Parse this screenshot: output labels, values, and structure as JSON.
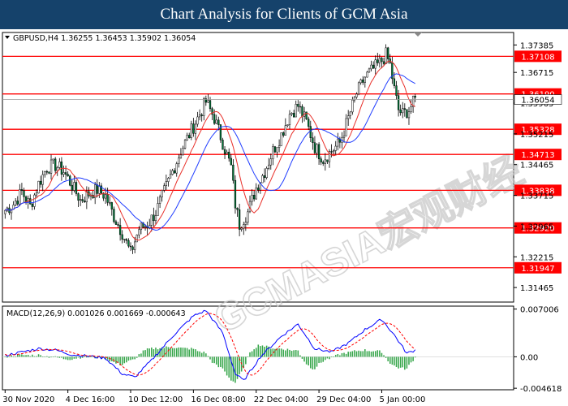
{
  "title": "Chart Analysis for Clients of GCM Asia",
  "watermark": "GCMASIA宏观财经",
  "colors": {
    "title_bg": "#15426b",
    "level_line": "#ff0000",
    "ma_red": "#e8302a",
    "ma_blue": "#1f3cff",
    "candle_bull": "#ffffff",
    "candle_bear": "#007a3a",
    "macd_hist": "#37a64b",
    "macd_line": "#0000ff",
    "signal_line": "#ff0000"
  },
  "chart_data": [
    {
      "type": "candlestick",
      "symbol_info": "GBPUSD,H4  1.36255 1.36453 1.35902 1.36054",
      "current_price_label": "1.36054",
      "y_ticks": [
        "1.37385",
        "1.36715",
        "1.35965",
        "1.35215",
        "1.34465",
        "1.33715",
        "1.32965",
        "1.32215",
        "1.31465"
      ],
      "ylim": [
        1.3115,
        1.3765
      ],
      "levels": [
        {
          "value": 1.37108,
          "label": "1.37108"
        },
        {
          "value": 1.3619,
          "label": "1.36190"
        },
        {
          "value": 1.35328,
          "label": "1.35328"
        },
        {
          "value": 1.34713,
          "label": "1.34713"
        },
        {
          "value": 1.33838,
          "label": "1.33838"
        },
        {
          "value": 1.3292,
          "label": "1.32920"
        },
        {
          "value": 1.31947,
          "label": "1.31947"
        }
      ],
      "anchors": [
        [
          0,
          1.3335
        ],
        [
          4,
          1.335
        ],
        [
          8,
          1.338
        ],
        [
          12,
          1.3345
        ],
        [
          16,
          1.34
        ],
        [
          20,
          1.344
        ],
        [
          24,
          1.3445
        ],
        [
          28,
          1.343
        ],
        [
          32,
          1.3395
        ],
        [
          36,
          1.336
        ],
        [
          40,
          1.3375
        ],
        [
          44,
          1.3385
        ],
        [
          48,
          1.337
        ],
        [
          52,
          1.332
        ],
        [
          56,
          1.328
        ],
        [
          60,
          1.323
        ],
        [
          64,
          1.329
        ],
        [
          68,
          1.33
        ],
        [
          72,
          1.333
        ],
        [
          76,
          1.338
        ],
        [
          80,
          1.343
        ],
        [
          84,
          1.348
        ],
        [
          88,
          1.352
        ],
        [
          92,
          1.356
        ],
        [
          96,
          1.36
        ],
        [
          100,
          1.356
        ],
        [
          104,
          1.35
        ],
        [
          108,
          1.344
        ],
        [
          110,
          1.335
        ],
        [
          112,
          1.33
        ],
        [
          116,
          1.333
        ],
        [
          120,
          1.339
        ],
        [
          124,
          1.343
        ],
        [
          128,
          1.348
        ],
        [
          132,
          1.352
        ],
        [
          136,
          1.357
        ],
        [
          140,
          1.359
        ],
        [
          144,
          1.355
        ],
        [
          148,
          1.349
        ],
        [
          152,
          1.346
        ],
        [
          156,
          1.348
        ],
        [
          160,
          1.35
        ],
        [
          164,
          1.356
        ],
        [
          168,
          1.362
        ],
        [
          172,
          1.366
        ],
        [
          176,
          1.368
        ],
        [
          180,
          1.37
        ],
        [
          182,
          1.3715
        ],
        [
          184,
          1.369
        ],
        [
          186,
          1.363
        ],
        [
          188,
          1.358
        ],
        [
          190,
          1.357
        ],
        [
          193,
          1.358
        ],
        [
          196,
          1.3605
        ]
      ]
    },
    {
      "type": "macd",
      "label": "MACD(12,26,9) 0.001026 0.001669 -0.000643",
      "y_ticks": [
        "0.007006",
        "0.00",
        "-0.004618"
      ],
      "ylim": [
        -0.0046,
        0.0072
      ],
      "anchors": [
        [
          0,
          0.0002
        ],
        [
          8,
          0.0007
        ],
        [
          16,
          0.0012
        ],
        [
          24,
          0.001
        ],
        [
          32,
          0.0003
        ],
        [
          40,
          0.0001
        ],
        [
          48,
          -0.0002
        ],
        [
          56,
          -0.0025
        ],
        [
          62,
          -0.003
        ],
        [
          70,
          -0.0005
        ],
        [
          80,
          0.003
        ],
        [
          90,
          0.006
        ],
        [
          96,
          0.0068
        ],
        [
          104,
          0.0035
        ],
        [
          110,
          -0.0025
        ],
        [
          114,
          -0.0035
        ],
        [
          122,
          0.0
        ],
        [
          132,
          0.003
        ],
        [
          140,
          0.0048
        ],
        [
          148,
          0.0012
        ],
        [
          156,
          0.0007
        ],
        [
          164,
          0.002
        ],
        [
          172,
          0.004
        ],
        [
          180,
          0.0055
        ],
        [
          186,
          0.0032
        ],
        [
          192,
          0.0005
        ],
        [
          196,
          0.001
        ]
      ]
    }
  ],
  "x_ticks": [
    {
      "bar": 0,
      "label": "30 Nov 2020"
    },
    {
      "bar": 30,
      "label": "4 Dec 16:00"
    },
    {
      "bar": 60,
      "label": "10 Dec 12:00"
    },
    {
      "bar": 90,
      "label": "16 Dec 08:00"
    },
    {
      "bar": 120,
      "label": "22 Dec 04:00"
    },
    {
      "bar": 150,
      "label": "29 Dec 04:00"
    },
    {
      "bar": 180,
      "label": "5 Jan 00:00"
    }
  ]
}
